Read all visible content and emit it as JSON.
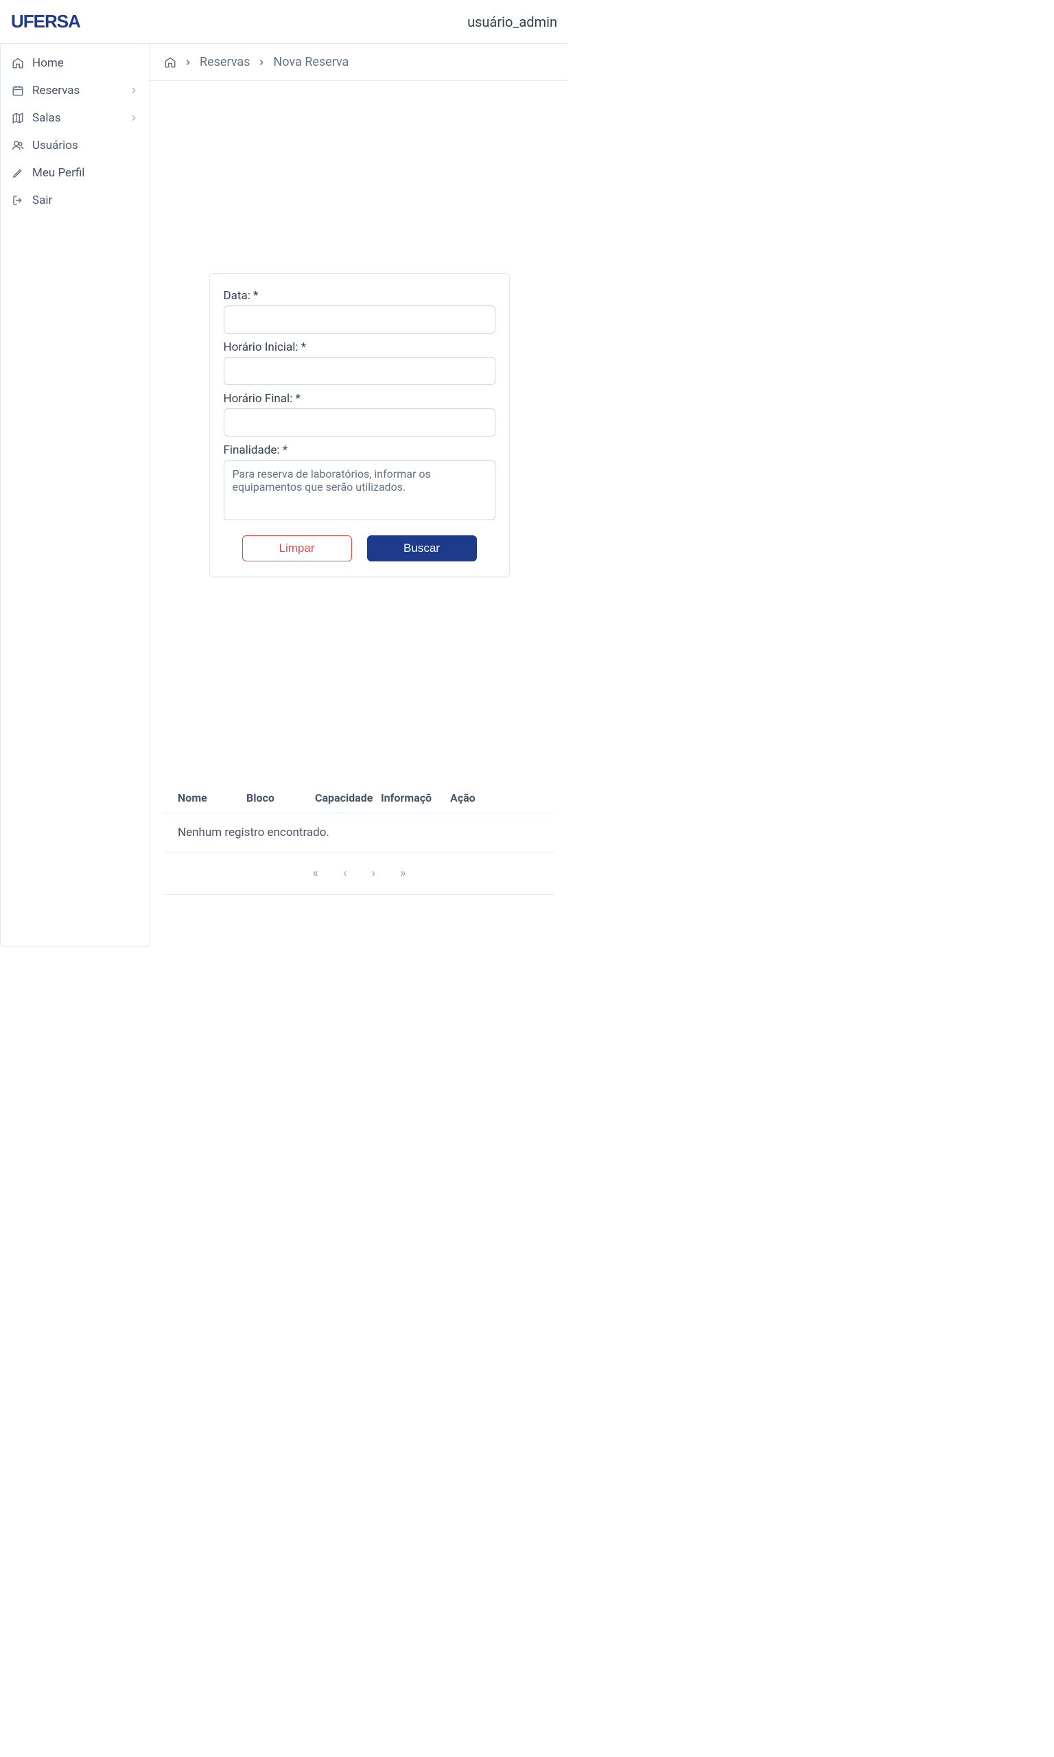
{
  "header": {
    "logo": "UFERSA",
    "user": "usuário_admin"
  },
  "sidebar": {
    "items": [
      {
        "label": "Home",
        "hasChevron": false
      },
      {
        "label": "Reservas",
        "hasChevron": true
      },
      {
        "label": "Salas",
        "hasChevron": true
      },
      {
        "label": "Usuários",
        "hasChevron": false
      },
      {
        "label": "Meu Perfil",
        "hasChevron": false
      },
      {
        "label": "Sair",
        "hasChevron": false
      }
    ]
  },
  "breadcrumb": {
    "items": [
      "Reservas",
      "Nova Reserva"
    ]
  },
  "form": {
    "data_label": "Data: *",
    "horario_inicial_label": "Horário Inicial: *",
    "horario_final_label": "Horário Final: *",
    "finalidade_label": "Finalidade: *",
    "finalidade_placeholder": "Para reserva de laboratórios, informar os equipamentos que serão utilizados.",
    "clear_button": "Limpar",
    "search_button": "Buscar"
  },
  "table": {
    "columns": {
      "nome": "Nome",
      "bloco": "Bloco",
      "capacidade": "Capacidade",
      "informacoes": "Informaçõ",
      "acao": "Ação"
    },
    "empty_message": "Nenhum registro encontrado."
  }
}
